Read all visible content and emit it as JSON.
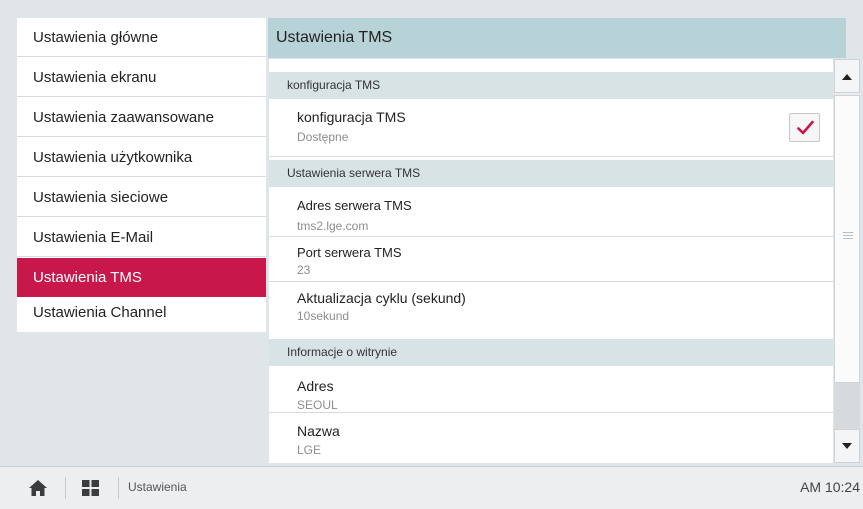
{
  "menu": {
    "items": [
      {
        "label": "Ustawienia główne"
      },
      {
        "label": "Ustawienia ekranu"
      },
      {
        "label": "Ustawienia zaawansowane"
      },
      {
        "label": "Ustawienia użytkownika"
      },
      {
        "label": "Ustawienia sieciowe"
      },
      {
        "label": "Ustawienia E-Mail"
      },
      {
        "label": "Ustawienia TMS",
        "selected": true
      },
      {
        "label": "Ustawienia Channel"
      }
    ]
  },
  "panel": {
    "title": "Ustawienia TMS",
    "sections": {
      "tms_config": {
        "header": "konfiguracja TMS",
        "row": {
          "label": "konfiguracja TMS",
          "value": "Dostępne",
          "checked": true
        }
      },
      "server": {
        "header": "Ustawienia serwera TMS",
        "rows": [
          {
            "label": "Adres serwera TMS",
            "value": "tms2.lge.com"
          },
          {
            "label": "Port serwera TMS",
            "value": "23"
          },
          {
            "label": "Aktualizacja cyklu (sekund)",
            "value": "10sekund"
          }
        ]
      },
      "site": {
        "header": "Informacje o witrynie",
        "rows": [
          {
            "label": "Adres",
            "value": "SEOUL"
          },
          {
            "label": "Nazwa",
            "value": "LGE"
          }
        ]
      }
    }
  },
  "bottombar": {
    "icons": [
      "home-icon",
      "apps-grid-icon"
    ],
    "breadcrumb": "Ustawienia",
    "clock": "AM 10:24"
  },
  "colors": {
    "accent": "#c8174a",
    "header_bg": "#b8d3d7",
    "section_bg": "#d8e3e6",
    "frame_bg": "#dfe5e8"
  }
}
